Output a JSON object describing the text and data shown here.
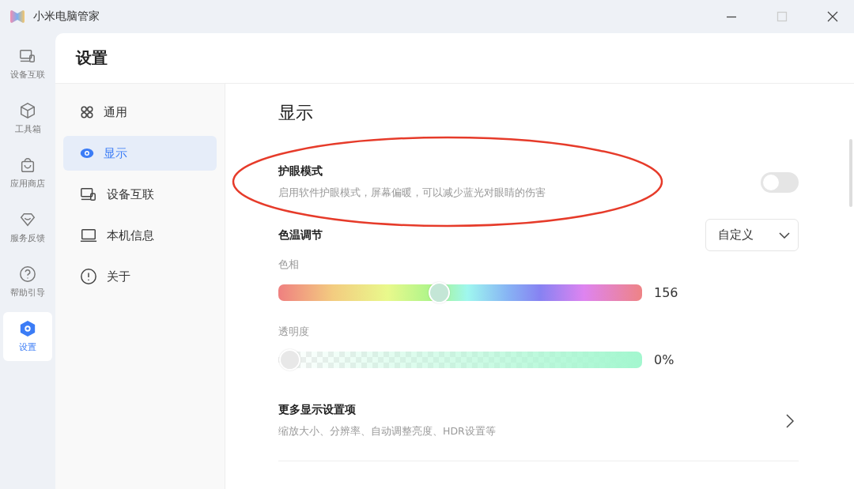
{
  "window": {
    "title": "小米电脑管家",
    "controls": [
      {
        "kind": "minimize",
        "disabled": false
      },
      {
        "kind": "maximize",
        "disabled": true
      },
      {
        "kind": "close",
        "disabled": false
      }
    ]
  },
  "rail": [
    {
      "label": "设备互联",
      "selected": false
    },
    {
      "label": "工具箱",
      "selected": false
    },
    {
      "label": "应用商店",
      "selected": false
    },
    {
      "label": "服务反馈",
      "selected": false
    },
    {
      "label": "帮助引导",
      "selected": false
    },
    {
      "label": "设置",
      "selected": true
    }
  ],
  "header": {
    "title": "设置"
  },
  "menu": [
    {
      "label": "通用",
      "selected": false
    },
    {
      "label": "显示",
      "selected": true
    },
    {
      "label": "设备互联",
      "selected": false
    },
    {
      "label": "本机信息",
      "selected": false
    },
    {
      "label": "关于",
      "selected": false
    }
  ],
  "content": {
    "title": "显示",
    "eye_care": {
      "title": "护眼模式",
      "description": "启用软件护眼模式，屏幕偏暖，可以减少蓝光对眼睛的伤害",
      "on": false
    },
    "color_temp": {
      "title": "色温调节",
      "dropdown": "自定义"
    },
    "sliders": [
      {
        "kind": "hue",
        "label": "色相",
        "level": 0.437,
        "reading": "156"
      },
      {
        "kind": "opacity",
        "label": "透明度",
        "level": 0,
        "reading": "0%"
      }
    ],
    "more": {
      "title": "更多显示设置项",
      "description": "缩放大小、分辨率、自动调整亮度、HDR设置等"
    }
  },
  "annotations": [
    {
      "kind": "ellipse"
    }
  ]
}
